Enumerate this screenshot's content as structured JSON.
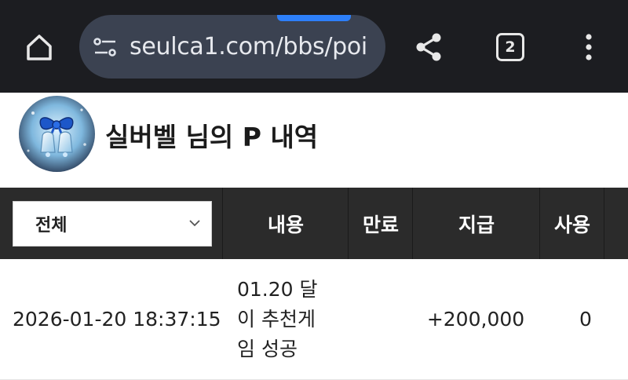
{
  "browser": {
    "url": "seulca1.com/bbs/poi",
    "tab_count": "2",
    "icons": {
      "home": "home-icon",
      "site_settings": "tune-icon",
      "share": "share-icon",
      "menu": "more-vert-icon"
    },
    "colors": {
      "toolbar": "#1c1d21",
      "urlbar": "#3b4251",
      "progress": "#2d7ff9"
    }
  },
  "header": {
    "title": "실버벨 님의 P 내역",
    "avatar": "christmas-bells-avatar"
  },
  "table": {
    "filter": {
      "selected": "전체",
      "icon": "chevron-down-icon"
    },
    "columns": [
      "내용",
      "만료",
      "지급",
      "사용"
    ],
    "rows": [
      {
        "date": "2026-01-20 18:37:15",
        "content_lines": [
          "01.20 달",
          "이 추천게",
          "임 성공"
        ],
        "expire": "",
        "grant": "+200,000",
        "use": "0"
      }
    ]
  }
}
